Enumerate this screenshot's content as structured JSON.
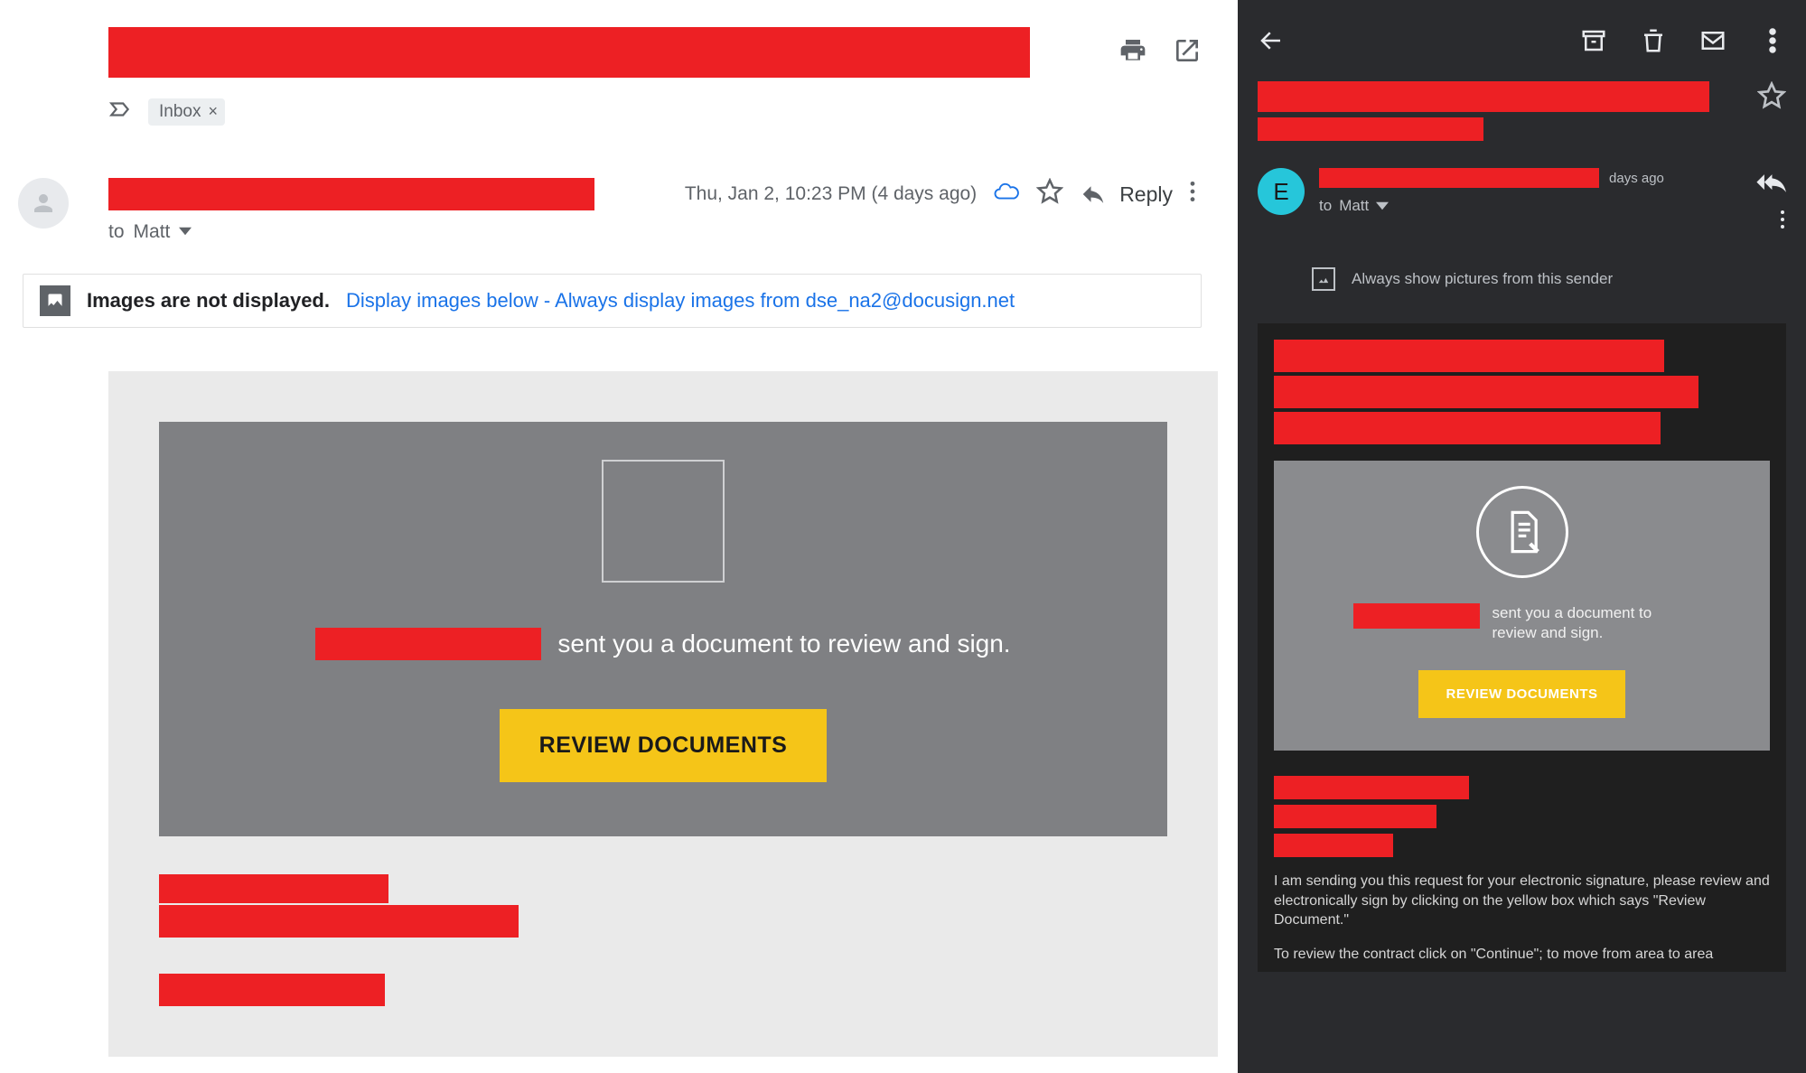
{
  "desktop": {
    "chip_label": "Inbox",
    "to_line_prefix": "to",
    "to_name": "Matt",
    "timestamp": "Thu, Jan 2, 10:23 PM (4 days ago)",
    "reply_label": "Reply",
    "image_bar": {
      "bold": "Images are not displayed.",
      "link": "Display images below - Always display images from dse_na2@docusign.net"
    },
    "sent_text": "sent you a document to review and sign.",
    "review_btn": "REVIEW DOCUMENTS"
  },
  "mobile": {
    "avatar_initial": "E",
    "days_ago": "days ago",
    "to_line_prefix": "to",
    "to_name": "Matt",
    "show_pics": "Always show pictures from this sender",
    "sent_text": "sent you a document to review and sign.",
    "review_btn": "REVIEW DOCUMENTS",
    "para1": "I am sending you this request for your electronic signature, please review and electronically sign by clicking on the yellow box which says \"Review Document.\"",
    "para2": "To review the contract click on \"Continue\"; to move from area to area"
  }
}
